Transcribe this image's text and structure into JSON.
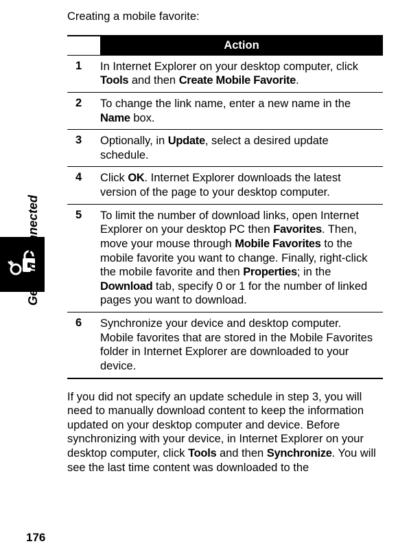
{
  "sidebar": {
    "section_label": "Getting Connected",
    "icon": "lock-key-icon"
  },
  "intro": "Creating a mobile favorite:",
  "table": {
    "header": "Action",
    "rows": [
      {
        "num": "1",
        "pre": "In Internet Explorer on your desktop computer, click ",
        "b1": "Tools",
        "mid1": " and then ",
        "b2": "Create Mobile Favorite",
        "post": "."
      },
      {
        "num": "2",
        "pre": "To change the link name, enter a new name in the ",
        "b1": "Name",
        "mid1": " box.",
        "b2": "",
        "post": ""
      },
      {
        "num": "3",
        "pre": "Optionally, in ",
        "b1": "Update",
        "mid1": ", select a desired update schedule.",
        "b2": "",
        "post": ""
      },
      {
        "num": "4",
        "pre": "Click ",
        "b1": "OK",
        "mid1": ". Internet Explorer downloads the latest version of the page to your desktop computer.",
        "b2": "",
        "post": ""
      },
      {
        "num": "5",
        "pre": "To limit the number of download links, open Internet Explorer on your desktop PC then ",
        "b1": "Favorites",
        "mid1": ". Then, move your mouse through ",
        "b2": "Mobile Favorites",
        "mid2": " to the mobile favorite you want to change. Finally, right-click the mobile favorite and then ",
        "b3": "Properties",
        "mid3": "; in the ",
        "b4": "Download",
        "post": " tab, specify 0 or 1 for the number of linked pages you want to download."
      },
      {
        "num": "6",
        "pre": "Synchronize your device and desktop computer. Mobile favorites that are stored in the Mobile Favorites folder in Internet Explorer are downloaded to your device.",
        "b1": "",
        "mid1": "",
        "b2": "",
        "post": ""
      }
    ]
  },
  "followup": {
    "pre": "If you did not specify an update schedule in step 3, you will need to manually download content to keep the information updated on your desktop computer and device. Before synchronizing with your device, in Internet Explorer on your desktop computer, click ",
    "b1": "Tools",
    "mid1": " and then ",
    "b2": "Synchronize",
    "post": ". You will see the last time content was downloaded to the"
  },
  "page_number": "176"
}
